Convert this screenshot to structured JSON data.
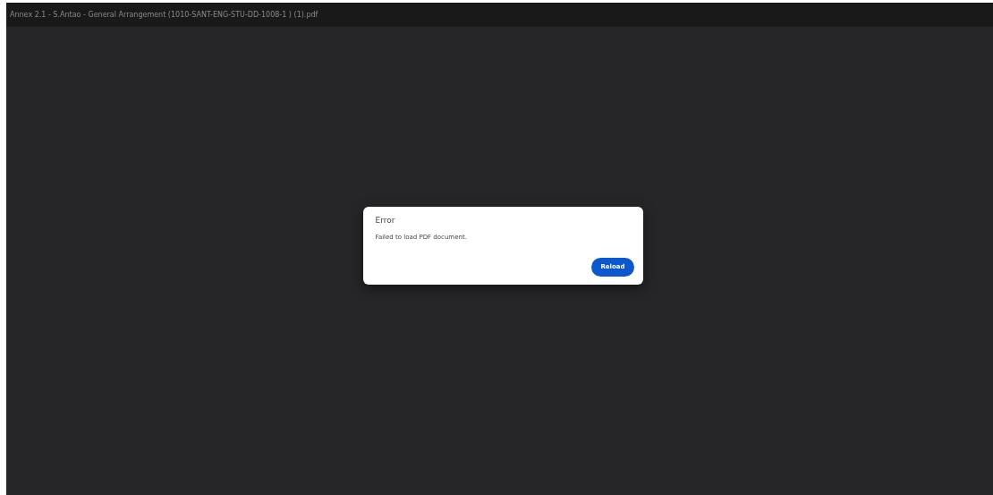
{
  "window": {
    "title": "Annex 2.1 - S.Antao - General Arrangement (1010-SANT-ENG-STU-DD-1008-1 ) (1).pdf"
  },
  "dialog": {
    "title": "Error",
    "message": "Failed to load PDF document.",
    "buttons": [
      "Reload"
    ]
  }
}
